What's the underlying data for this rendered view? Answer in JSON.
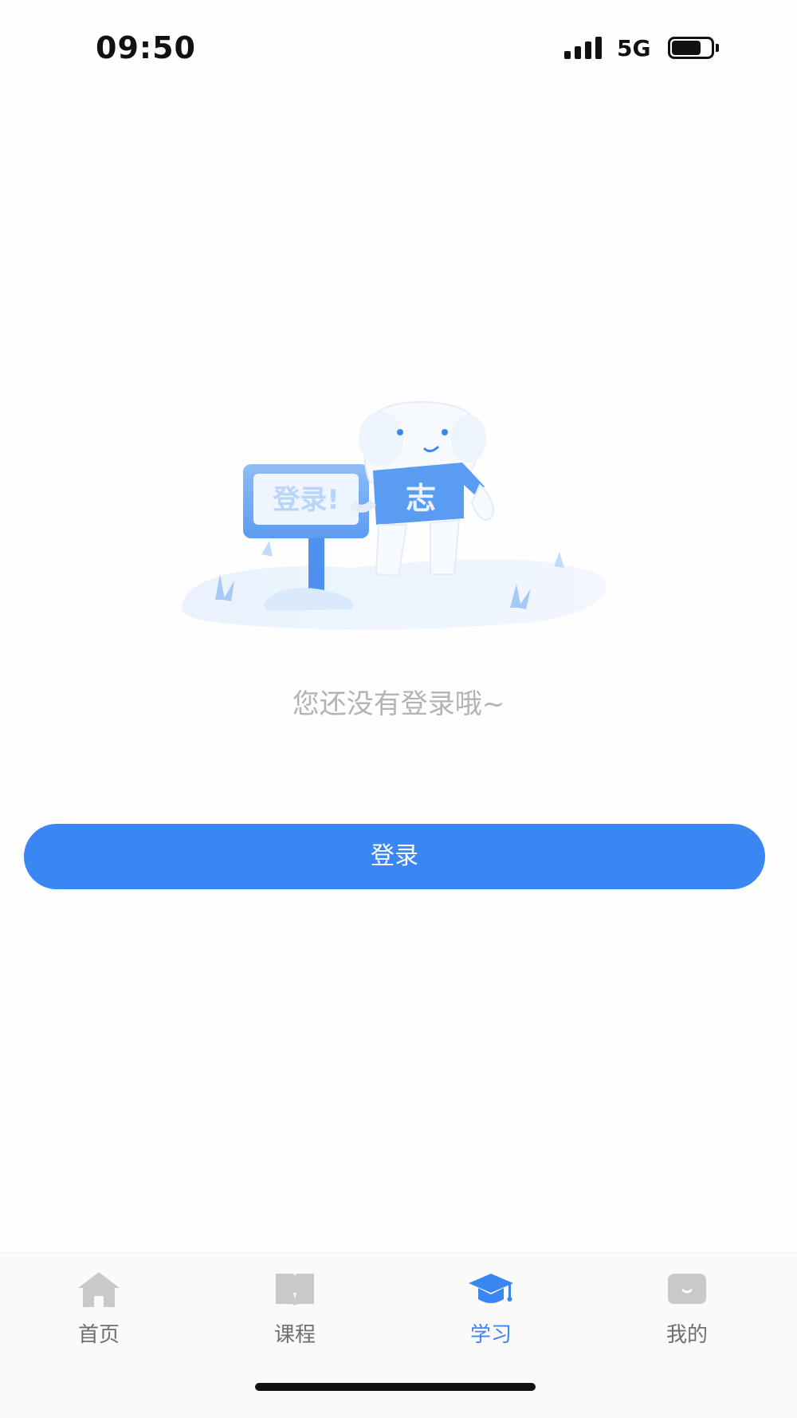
{
  "status_bar": {
    "time": "09:50",
    "network": "5G",
    "icons": [
      "signal-bars-icon",
      "battery-icon"
    ]
  },
  "illustration": {
    "sign_text": "登录!",
    "shirt_text": "志",
    "icon": "mascot-login-illustration"
  },
  "empty_state": {
    "message": "您还没有登录哦~"
  },
  "login_button": {
    "label": "登录"
  },
  "tab_bar": {
    "tabs": [
      {
        "label": "首页",
        "icon": "home-icon"
      },
      {
        "label": "课程",
        "icon": "book-icon"
      },
      {
        "label": "学习",
        "icon": "graduation-cap-icon",
        "active": true
      },
      {
        "label": "我的",
        "icon": "profile-icon"
      }
    ]
  },
  "colors": {
    "accent": "#3a86f3",
    "muted_text": "#b3b3b3",
    "inactive_icon": "#c9c9c9"
  }
}
